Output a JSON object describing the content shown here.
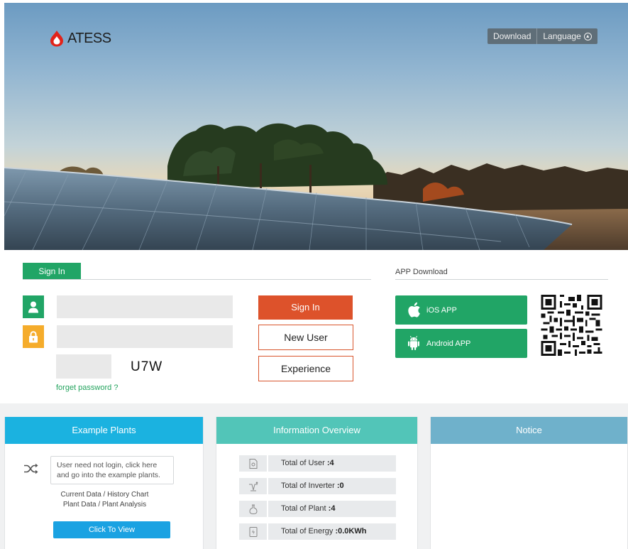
{
  "header": {
    "logo_text": "ATESS",
    "nav": {
      "download": "Download",
      "language": "Language"
    }
  },
  "signin": {
    "tab_label": "Sign In",
    "username_placeholder": "",
    "password_placeholder": "",
    "captcha_code": "U7W",
    "forget_password": "forget password ?",
    "buttons": {
      "sign_in": "Sign In",
      "new_user": "New User",
      "experience": "Experience"
    }
  },
  "app_download": {
    "title": "APP Download",
    "ios_label": "iOS APP",
    "android_label": "Android APP"
  },
  "panels": {
    "example": {
      "title": "Example Plants",
      "note_line1": "User need not login, click here",
      "note_line2": "and go into the example plants.",
      "links_line1": "Current Data / History Chart",
      "links_line2": "Plant Data / Plant Analysis",
      "view_button": "Click To View"
    },
    "info": {
      "title": "Information Overview",
      "stats": [
        {
          "label": "Total of User ",
          "value": ":4"
        },
        {
          "label": "Total of Inverter ",
          "value": ":0"
        },
        {
          "label": "Total of Plant ",
          "value": ":4"
        },
        {
          "label": "Total of Energy ",
          "value": ":0.0KWh"
        }
      ]
    },
    "notice": {
      "title": "Notice"
    }
  },
  "colors": {
    "brand_green": "#21a566",
    "sign_in_orange": "#dd522b",
    "lock_yellow": "#f5ac2b",
    "example_blue": "#1bb2e0",
    "info_teal": "#52c5b8",
    "notice_blue": "#6fb1cb",
    "logo_red": "#e2231a"
  },
  "icons": {
    "user": "user-icon",
    "lock": "lock-icon",
    "apple": "apple-icon",
    "android": "android-icon",
    "shuffle": "shuffle-icon",
    "language": "circle-arrow-icon"
  }
}
